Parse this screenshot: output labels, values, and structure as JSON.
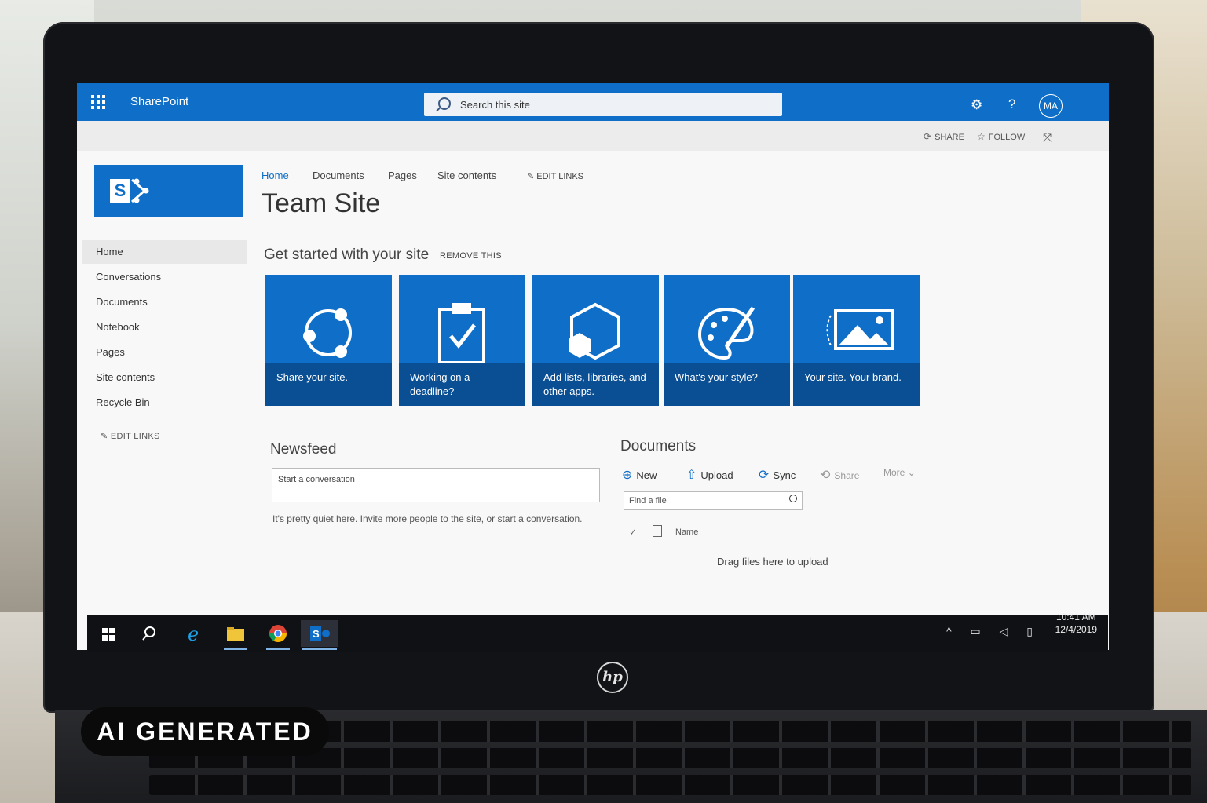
{
  "suitebar": {
    "app_title": "SharePoint",
    "search_placeholder": "Search this site",
    "avatar_initials": "MA",
    "help_label": "?"
  },
  "sharebar": {
    "share_label": "SHARE",
    "follow_label": "FOLLOW"
  },
  "site_logo": {
    "letter": "S"
  },
  "leftnav": {
    "items": [
      {
        "label": "Home"
      },
      {
        "label": "Conversations"
      },
      {
        "label": "Documents"
      },
      {
        "label": "Notebook"
      },
      {
        "label": "Pages"
      },
      {
        "label": "Site contents"
      },
      {
        "label": "Recycle Bin"
      }
    ],
    "edit_links": "EDIT LINKS"
  },
  "topnav": {
    "items": [
      {
        "label": "Home"
      },
      {
        "label": "Documents"
      },
      {
        "label": "Pages"
      },
      {
        "label": "Site contents"
      }
    ],
    "edit_links": "EDIT LINKS"
  },
  "page_title": "Team Site",
  "get_started": {
    "title": "Get started with your site",
    "remove": "REMOVE THIS",
    "tiles": [
      {
        "label": "Share your site.",
        "icon": "share-circle-icon"
      },
      {
        "label": "Working on a deadline?",
        "icon": "clipboard-check-icon"
      },
      {
        "label": "Add lists, libraries, and other apps.",
        "icon": "hexagon-apps-icon"
      },
      {
        "label": "What's your style?",
        "icon": "palette-icon"
      },
      {
        "label": "Your site. Your brand.",
        "icon": "picture-frame-icon"
      }
    ]
  },
  "newsfeed": {
    "title": "Newsfeed",
    "placeholder": "Start a conversation",
    "hint": "It's pretty quiet here. Invite more people to the site, or start a conversation."
  },
  "documents": {
    "title": "Documents",
    "commands": {
      "new": "New",
      "upload": "Upload",
      "sync": "Sync",
      "share": "Share",
      "more": "More"
    },
    "find_placeholder": "Find a file",
    "column_name": "Name",
    "drag_hint": "Drag files here to upload"
  },
  "taskbar": {
    "time": "10:41 AM",
    "date": "12/4/2019",
    "sp_letter": "S"
  },
  "badge": {
    "text": "AI GENERATED"
  },
  "laptop": {
    "brand": "hp"
  },
  "colors": {
    "accent": "#0e6ec8",
    "tile_caption": "#0a4f94"
  }
}
